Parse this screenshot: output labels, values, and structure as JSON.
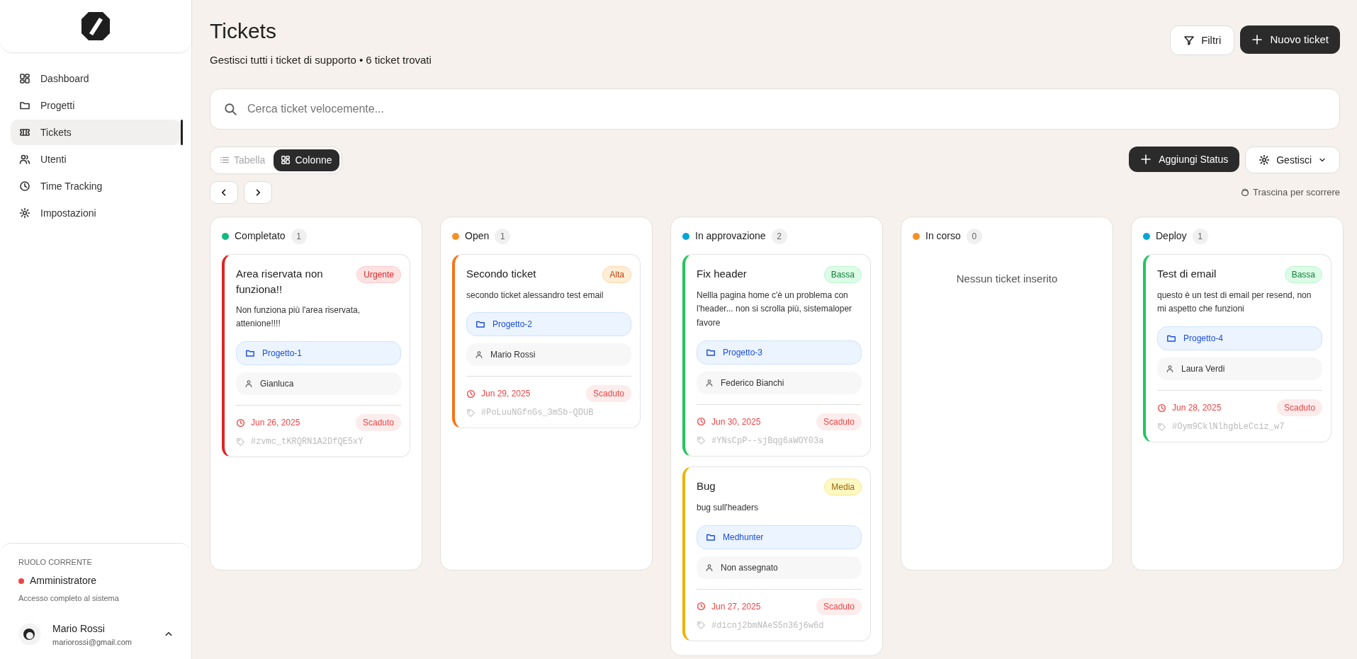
{
  "sidebar": {
    "items": [
      {
        "label": "Dashboard",
        "selected": false
      },
      {
        "label": "Progetti",
        "selected": false
      },
      {
        "label": "Tickets",
        "selected": true
      },
      {
        "label": "Utenti",
        "selected": false
      },
      {
        "label": "Time Tracking",
        "selected": false
      },
      {
        "label": "Impostazioni",
        "selected": false
      }
    ],
    "role": {
      "caption": "RUOLO CORRENTE",
      "name": "Amministratore",
      "color": "#ef4444",
      "description": "Accesso completo al sistema"
    },
    "user": {
      "name": "Mario Rossi",
      "email": "mariorossi@gmail.com"
    }
  },
  "header": {
    "title": "Tickets",
    "subtitle": "Gestisci tutti i ticket di supporto • 6 ticket trovati",
    "filter_button": "Filtri",
    "new_button": "Nuovo ticket"
  },
  "search": {
    "placeholder": "Cerca ticket velocemente..."
  },
  "view_toggle": [
    {
      "label": "Tabella",
      "selected": false
    },
    {
      "label": "Colonne",
      "selected": true
    }
  ],
  "add_status_button": "Aggiungi Status",
  "manage_button": "Gestisci",
  "drag_hint": "Trascina per scorrere",
  "columns": [
    {
      "name": "Completato",
      "color": "#10b981",
      "count": "1",
      "tickets": [
        {
          "title": "Area riservata non funziona!!",
          "kind": "urgent",
          "priority_label": "Urgente",
          "description": "Non funziona più l'area riservata, attenione!!!!",
          "project": "Progetto-1",
          "assignee": "Gianluca",
          "due_date": "Jun 26, 2025",
          "due_status": "Scaduto",
          "code": "#zvmc_tKRQRN1A2DfQE5xY"
        }
      ]
    },
    {
      "name": "Open",
      "color": "#f59126",
      "count": "1",
      "tickets": [
        {
          "title": "Secondo ticket",
          "kind": "high",
          "priority_label": "Alta",
          "description": "secondo ticket alessandro test email",
          "project": "Progetto-2",
          "assignee": "Mario Rossi",
          "due_date": "Jun 29, 2025",
          "due_status": "Scaduto",
          "code": "#PoLuuNGfnGs_3mSb-QDUB"
        }
      ]
    },
    {
      "name": "In approvazione",
      "color": "#06a6d4",
      "count": "2",
      "tickets": [
        {
          "title": "Fix header",
          "kind": "low",
          "priority_label": "Bassa",
          "description": "Nellla pagina home c'è un problema con l'header... non si scrolla più, sistemaloper favore",
          "project": "Progetto-3",
          "assignee": "Federico Bianchi",
          "due_date": "Jun 30, 2025",
          "due_status": "Scaduto",
          "code": "#YNsCpP--sjBqg6aWOY03a"
        },
        {
          "title": "Bug",
          "kind": "medium",
          "priority_label": "Media",
          "description": "bug sull'headers",
          "project": "Medhunter",
          "assignee": "Non assegnato",
          "due_date": "Jun 27, 2025",
          "due_status": "Scaduto",
          "code": "#dicnj2bmNAeS5n36j6w6d"
        }
      ]
    },
    {
      "name": "In corso",
      "color": "#f59126",
      "count": "0",
      "empty_text": "Nessun ticket inserito"
    },
    {
      "name": "Deploy",
      "color": "#06a6d4",
      "count": "1",
      "tickets": [
        {
          "title": "Test di email",
          "kind": "low",
          "priority_label": "Bassa",
          "description": "questo è un test di email per resend, non mi aspetto che funzioni",
          "project": "Progetto-4",
          "assignee": "Laura Verdi",
          "due_date": "Jun 28, 2025",
          "due_status": "Scaduto",
          "code": "#Oym9CklNlhgbLeCciz_w7"
        }
      ]
    }
  ]
}
